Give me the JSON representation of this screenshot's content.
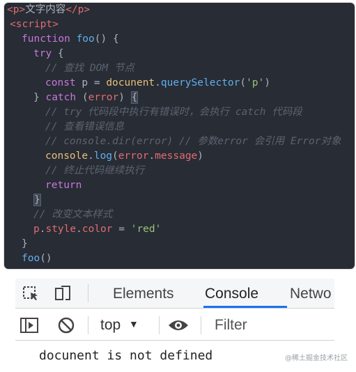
{
  "code": {
    "l1_open": "<p>",
    "l1_text": "文字内容",
    "l1_close": "</p>",
    "l2": "<script>",
    "l3_kw": "function",
    "l3_fn": "foo",
    "l3_rest": "() {",
    "l4_kw": "try",
    "l4_rest": " {",
    "l5": "// 查找 DOM 节点",
    "l6_kw": "const",
    "l6_p": " p = ",
    "l6_obj": "docunent",
    "l6_dot": ".",
    "l6_m": "querySelector",
    "l6_a": "(",
    "l6_s": "'p'",
    "l6_b": ")",
    "l7_a": "} ",
    "l7_kw": "catch",
    "l7_b": " (",
    "l7_err": "error",
    "l7_c": ") ",
    "l7_brace": "{",
    "l8": "// try 代码段中执行有错误时，会执行 catch 代码段",
    "l9": "// 查看错误信息",
    "l10": "// console.dir(error) // 参数error 会引用 Error对象",
    "l11_obj": "console",
    "l11_dot": ".",
    "l11_m": "log",
    "l11_a": "(",
    "l11_err": "error",
    "l11_dot2": ".",
    "l11_prop": "message",
    "l11_b": ")",
    "l12": "// 终止代码继续执行",
    "l13": "return",
    "l14": "}",
    "l15": "// 改变文本样式",
    "l16_p": "p",
    "l16_d1": ".",
    "l16_style": "style",
    "l16_d2": ".",
    "l16_color": "color",
    "l16_eq": " = ",
    "l16_s": "'red'",
    "l17": "}",
    "l18_fn": "foo",
    "l18_rest": "()"
  },
  "devtools": {
    "tabs": [
      "Elements",
      "Console",
      "Netwo"
    ],
    "active_tab": "Console",
    "context": "top",
    "filter_placeholder": "Filter"
  },
  "console": {
    "message": "docunent is not defined"
  },
  "watermark": "@稀土掘金技术社区",
  "colors": {
    "editor_bg": "#282c34",
    "active_tab_underline": "#1a73e8"
  }
}
